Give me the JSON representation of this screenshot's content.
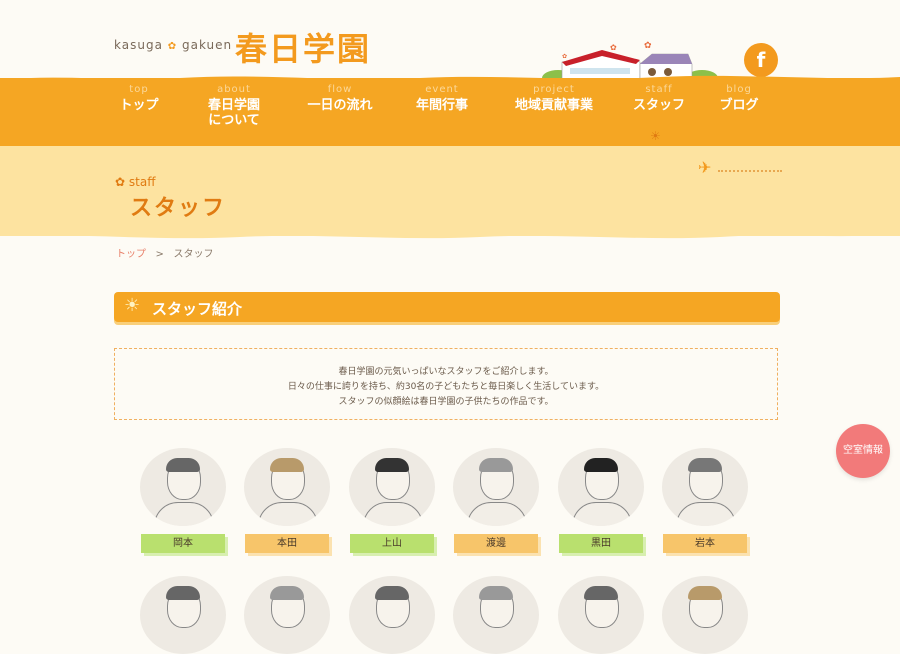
{
  "header": {
    "logo_en": "kasuga",
    "logo_en2": "gakuen",
    "logo_ja": "春日学園",
    "facebook": "f"
  },
  "nav": [
    {
      "en": "top",
      "ja": "トップ"
    },
    {
      "en": "about",
      "ja": "春日学園\nについて"
    },
    {
      "en": "flow",
      "ja": "一日の流れ"
    },
    {
      "en": "event",
      "ja": "年間行事"
    },
    {
      "en": "project",
      "ja": "地域貢献事業"
    },
    {
      "en": "staff",
      "ja": "スタッフ"
    },
    {
      "en": "blog",
      "ja": "ブログ"
    }
  ],
  "banner": {
    "en": "staff",
    "ja": "スタッフ"
  },
  "breadcrumb": {
    "home": "トップ",
    "sep": ">",
    "current": "スタッフ"
  },
  "section": {
    "title": "スタッフ紹介"
  },
  "intro": [
    "春日学園の元気いっぱいなスタッフをご紹介します。",
    "日々の仕事に誇りを持ち、約30名の子どもたちと毎日楽しく生活しています。",
    "スタッフの似顔絵は春日学園の子供たちの作品です。"
  ],
  "staff": [
    {
      "name": "岡本",
      "tag": "green"
    },
    {
      "name": "本田",
      "tag": "orange"
    },
    {
      "name": "上山",
      "tag": "green"
    },
    {
      "name": "渡邊",
      "tag": "orange"
    },
    {
      "name": "黒田",
      "tag": "green"
    },
    {
      "name": "岩本",
      "tag": "orange"
    }
  ],
  "vacancy": "空室情報",
  "colors": {
    "primary": "#f5a623",
    "banner": "#fde3a0",
    "green_tag": "#b9e06e",
    "orange_tag": "#f7c56a",
    "vacancy": "#f27a7a"
  }
}
